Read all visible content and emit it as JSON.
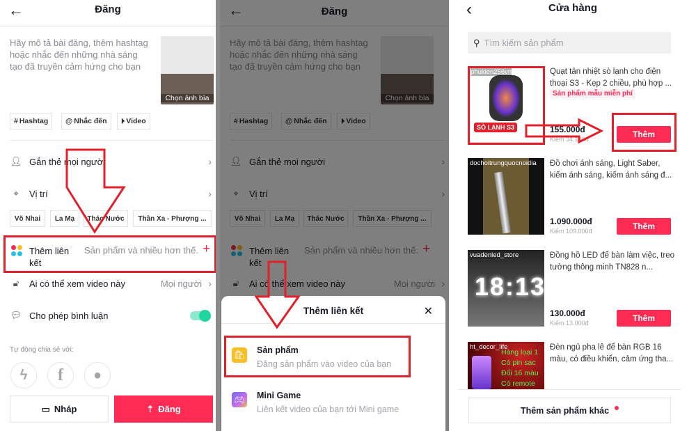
{
  "colors": {
    "accent": "#fe2c55",
    "annotation": "#e0202a",
    "toggle": "#20d5a0"
  },
  "post": {
    "title": "Đăng",
    "caption_placeholder": "Hãy mô tả bài đăng, thêm hashtag hoặc nhắc đến những nhà sáng tạo đã truyền cảm hứng cho bạn",
    "cover_label": "Chọn ảnh bìa",
    "chips": [
      "Hashtag",
      "Nhắc đến",
      "Video"
    ],
    "tag_people": "Gắn thẻ mọi người",
    "location": "Vị trí",
    "locations": [
      "Võ Nhai",
      "La Mạ",
      "Thác Nước",
      "Thần Xa - Phượng ..."
    ],
    "add_link": "Thêm liên kết",
    "add_link_hint": "Sản phẩm và nhiều hơn thế.",
    "privacy": "Ai có thể xem video này",
    "privacy_value": "Mọi người",
    "comments": "Cho phép bình luận",
    "comments_enabled": true,
    "auto_share": "Tự động chia sẻ với:",
    "draft": "Nháp",
    "publish": "Đăng"
  },
  "sheet": {
    "title": "Thêm liên kết",
    "options": [
      {
        "title": "Sản phẩm",
        "subtitle": "Đăng sản phẩm vào video của bạn",
        "icon": "shopping-bag-icon"
      },
      {
        "title": "Mini Game",
        "subtitle": "Liên kết video của bạn tới Mini game",
        "icon": "game-controller-icon"
      }
    ]
  },
  "shop": {
    "title": "Cửa hàng",
    "search_placeholder": "Tìm kiếm sản phẩm",
    "add_label": "Thêm",
    "more_label": "Thêm sản phẩm khác",
    "products": [
      {
        "store": "phukien256vn",
        "title": "Quạt tản nhiệt sò lạnh cho điện thoại S3 - Kẹp 2 chiều, phù hợp ...",
        "badge": "Sản phẩm mẫu miễn phí",
        "image_text": "SÒ LẠNH S3",
        "price": "155.000đ",
        "earn": "Kiếm 34.100đ"
      },
      {
        "store": "dochoitrungquocnoidia",
        "title": "Đồ chơi ánh sáng, Light Saber, kiếm ánh sáng, kiếm ánh sáng đ...",
        "price": "1.090.000đ",
        "earn": "Kiếm 109.000đ"
      },
      {
        "store": "vuadenled_store",
        "title": "Đồng hồ LED để bàn làm việc, treo tường thông minh TN828 n...",
        "image_text": "18:13",
        "price": "130.000đ",
        "earn": "Kiếm 13.000đ"
      },
      {
        "store": "ht_decor_life",
        "title": "Đèn ngủ pha lê để bàn RGB 16 màu, có điều khiển, cảm ứng tha...",
        "image_text": "Hàng loại 1\nCó pin sạc\nĐổi 16 màu\nCó remote"
      }
    ]
  }
}
